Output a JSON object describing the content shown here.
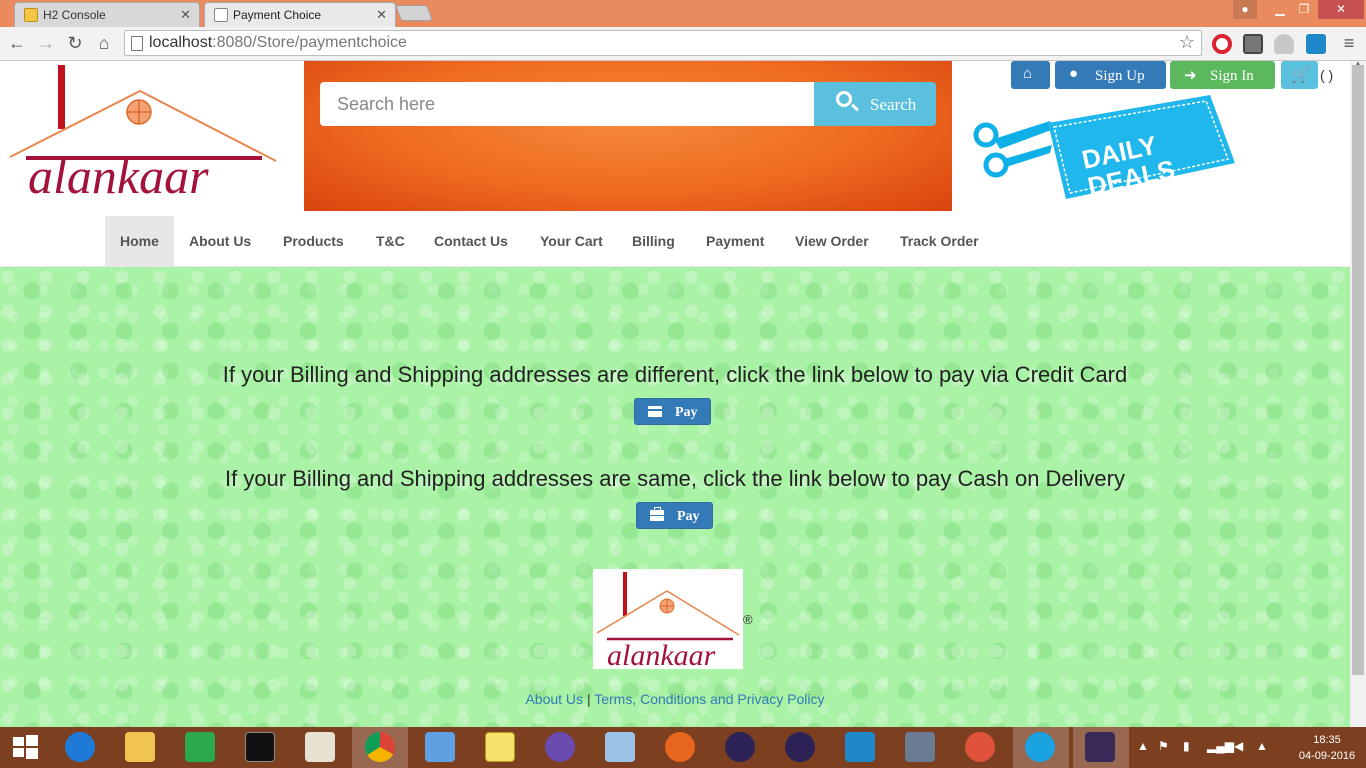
{
  "browser": {
    "tabs": [
      {
        "title": "H2 Console",
        "active": false
      },
      {
        "title": "Payment Choice",
        "active": true
      }
    ],
    "url_host": "localhost",
    "url_rest": ":8080/Store/paymentchoice"
  },
  "header": {
    "logo_text": "alankaar",
    "search_placeholder": "Search here",
    "search_label": "Search",
    "signup_label": "Sign Up",
    "signin_label": "Sign In",
    "cart_count": "( )",
    "deals_text_line1": "DAILY",
    "deals_text_line2": "DEALS"
  },
  "nav": {
    "items": [
      "Home",
      "About Us",
      "Products",
      "T&C",
      "Contact Us",
      "Your Cart",
      "Billing",
      "Payment",
      "View Order",
      "Track Order"
    ],
    "active": "Home"
  },
  "main": {
    "credit_message": "If your Billing and Shipping addresses are different, click the link below to pay via Credit Card",
    "credit_button": "Pay",
    "cod_message": "If your Billing and Shipping addresses are same, click the link below to pay Cash on Delivery",
    "cod_button": "Pay"
  },
  "footer": {
    "registered": "®",
    "about_link": "About Us",
    "separator": "|",
    "terms_link": "Terms, Conditions and Privacy Policy"
  },
  "taskbar": {
    "time": "18:35",
    "date": "04-09-2016"
  },
  "colors": {
    "primary": "#337ab7",
    "success": "#5cb85c",
    "info": "#5bc0de",
    "logo_red": "#a3123a",
    "roof_orange": "#e8864b",
    "page_green": "#a9f2a6",
    "tab_strip": "#e98b5e"
  }
}
